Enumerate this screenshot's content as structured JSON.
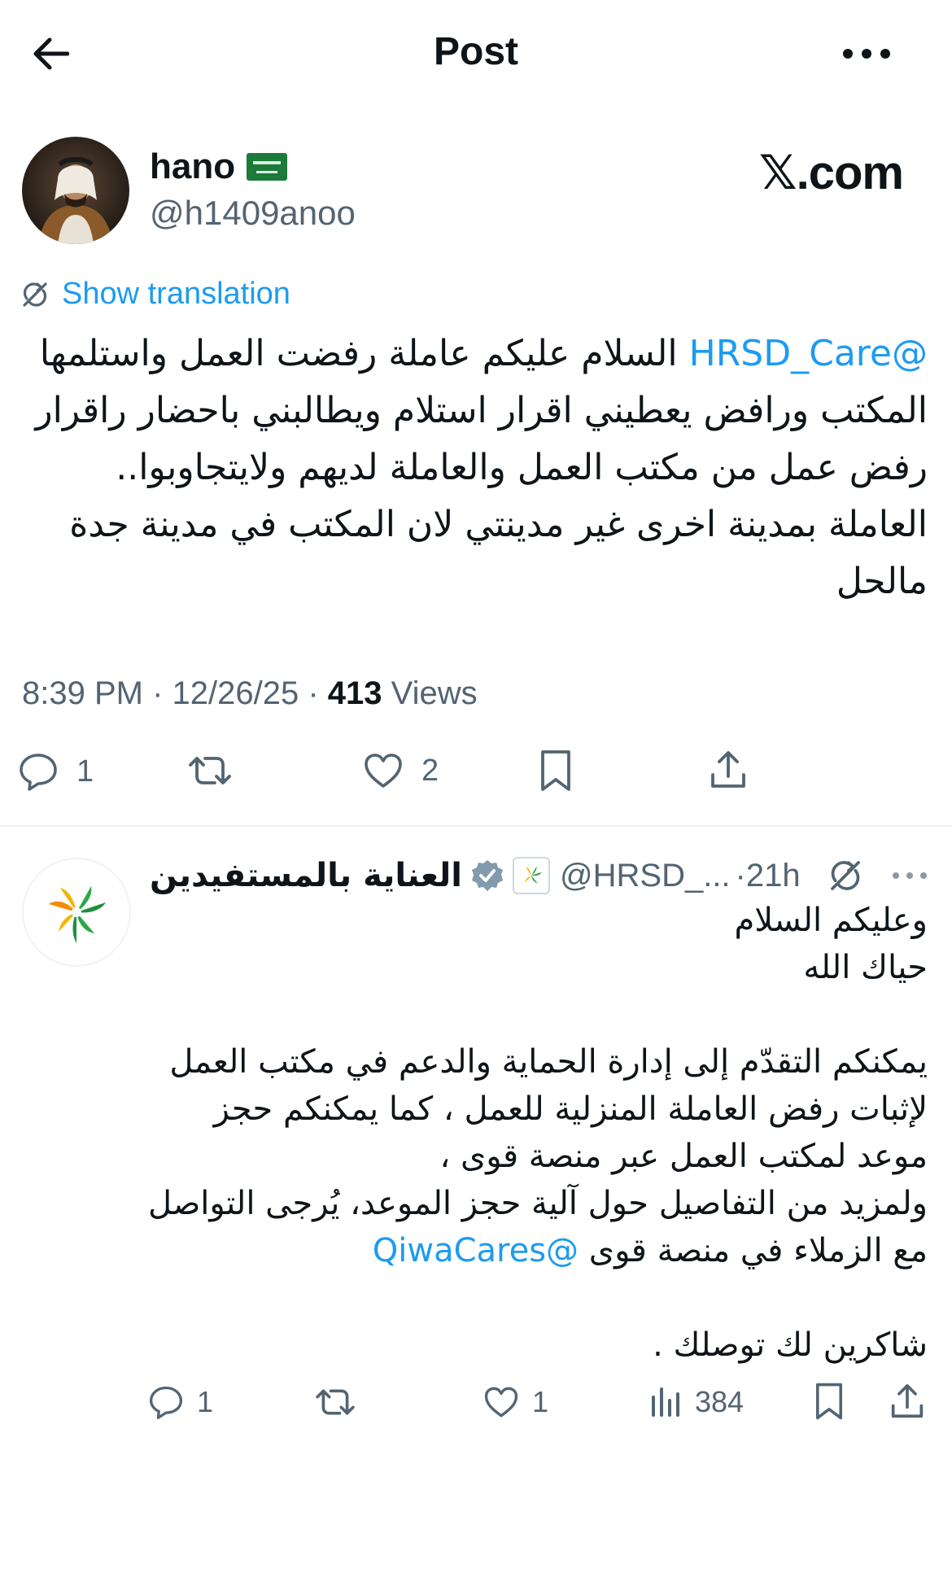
{
  "header": {
    "title": "Post",
    "back_icon": "arrow-left-icon",
    "more_icon": "more-horizontal-icon"
  },
  "post": {
    "author": {
      "display_name": "hano",
      "flag": "saudi-flag-emoji",
      "handle": "@h1409anoo"
    },
    "watermark": "𝕏.com",
    "show_translation": "Show translation",
    "mention": "@HRSD_Care",
    "text_line1": " السلام عليكم عاملة رفضت العمل",
    "text_rest": "واستلمها المكتب ورافض يعطيني اقرار استلام ويطالبني باحضار راقرار رفض عمل من مكتب العمل والعاملة لديهم ولايتجاوبوا.. العاملة بمدينة اخرى غير مدينتي لان المكتب في مدينة جدة مالحل",
    "time": "8:39 PM",
    "date": "12/26/25",
    "views_count": "413",
    "views_label": "Views",
    "actions": {
      "replies": "1",
      "retweets": "",
      "likes": "2"
    }
  },
  "reply": {
    "author": {
      "display_name": "العناية بالمستفيدين",
      "handle": "@HRSD_...",
      "time": "21h"
    },
    "lines": [
      "وعليكم السلام",
      "حياك الله",
      "",
      "يمكنكم التقدّم إلى إدارة الحماية والدعم في مكتب العمل لإثبات رفض العاملة المنزلية للعمل ، كما يمكنكم حجز موعد لمكتب العمل عبر منصة قوى ،",
      "ولمزيد من التفاصيل حول آلية حجز الموعد، يُرجى التواصل مع الزملاء في منصة قوى "
    ],
    "mention": "@QiwaCares",
    "closing": "شاكرين لك توصلك .",
    "actions": {
      "replies": "1",
      "likes": "1",
      "views": "384"
    }
  },
  "colors": {
    "text": "#0f1419",
    "secondary": "#536471",
    "link": "#1d9bf0",
    "divider": "#eff3f4"
  }
}
